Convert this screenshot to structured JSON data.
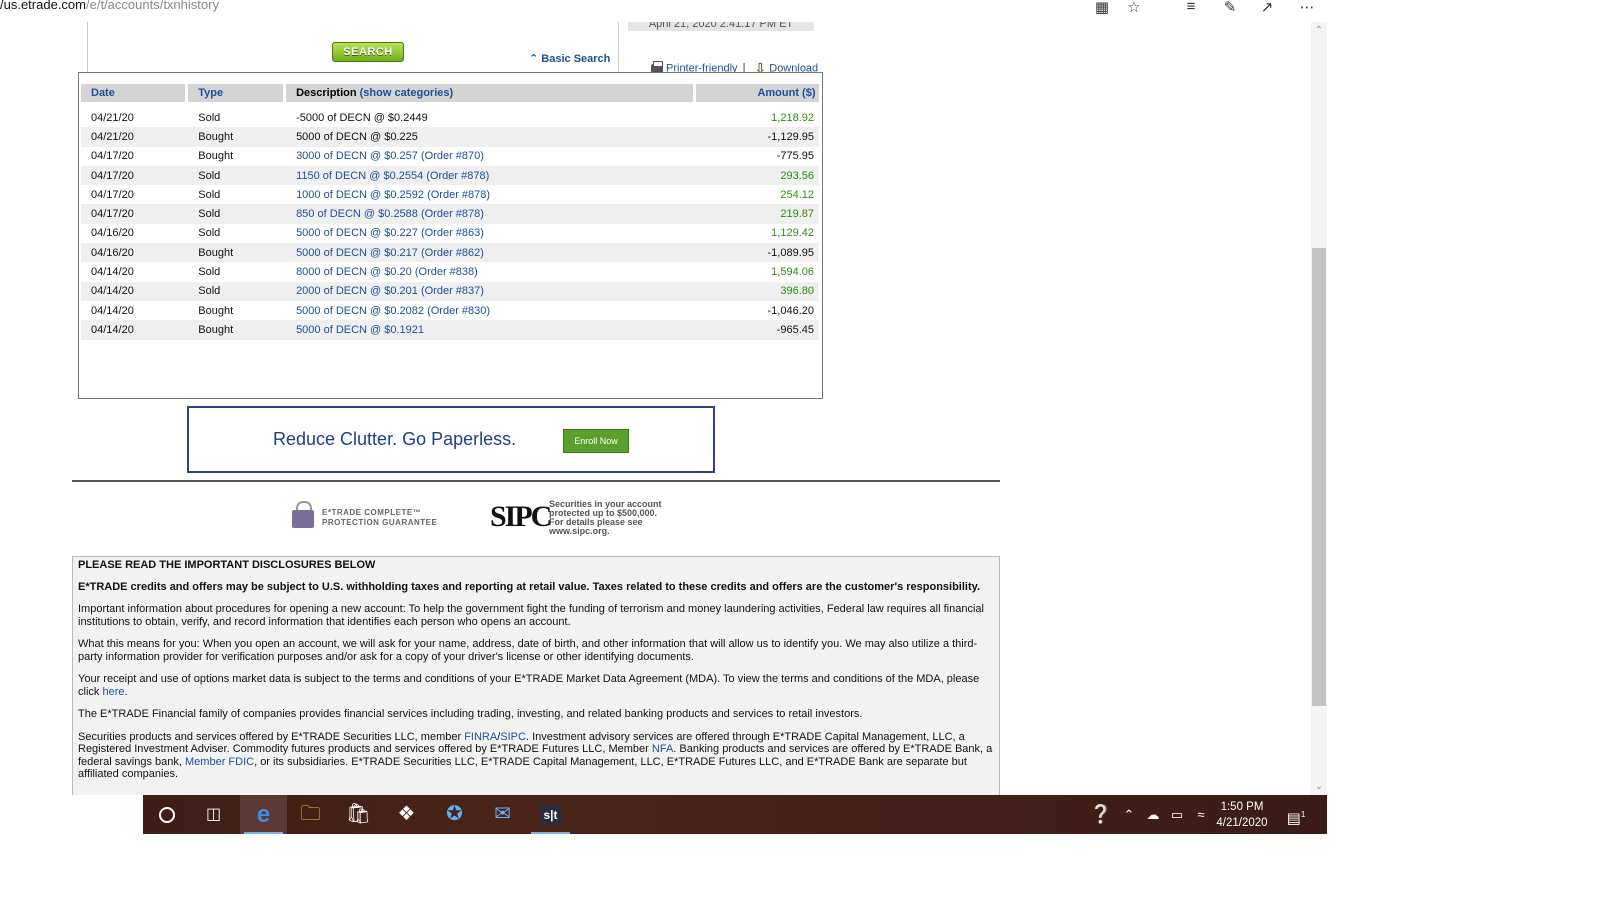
{
  "browser": {
    "url_domain": "/us.etrade.com",
    "url_path": "/e/t/accounts/txnhistory"
  },
  "search": {
    "button_label": "SEARCH",
    "basic_search_label": "Basic Search",
    "timestamp": "April 21, 2020 2:41:17 PM ET"
  },
  "actions": {
    "printer_label": "Printer-friendly",
    "separator": "|",
    "download_label": "Download"
  },
  "table": {
    "headers": {
      "date": "Date",
      "type": "Type",
      "description": "Description",
      "show_categories": "(show categories)",
      "amount": "Amount ($)"
    },
    "rows": [
      {
        "date": "04/21/20",
        "type": "Sold",
        "description": "-5000 of DECN @ $0.2449",
        "amount": "1,218.92",
        "positive": true,
        "link": false
      },
      {
        "date": "04/21/20",
        "type": "Bought",
        "description": "5000 of DECN @ $0.225",
        "amount": "-1,129.95",
        "positive": false,
        "link": false
      },
      {
        "date": "04/17/20",
        "type": "Bought",
        "description": "3000 of DECN @ $0.257 (Order #870)",
        "amount": "-775.95",
        "positive": false,
        "link": true
      },
      {
        "date": "04/17/20",
        "type": "Sold",
        "description": "1150 of DECN @ $0.2554 (Order #878)",
        "amount": "293.56",
        "positive": true,
        "link": true
      },
      {
        "date": "04/17/20",
        "type": "Sold",
        "description": "1000 of DECN @ $0.2592 (Order #878)",
        "amount": "254.12",
        "positive": true,
        "link": true
      },
      {
        "date": "04/17/20",
        "type": "Sold",
        "description": "850 of DECN @ $0.2588 (Order #878)",
        "amount": "219.87",
        "positive": true,
        "link": true
      },
      {
        "date": "04/16/20",
        "type": "Sold",
        "description": "5000 of DECN @ $0.227 (Order #863)",
        "amount": "1,129.42",
        "positive": true,
        "link": true
      },
      {
        "date": "04/16/20",
        "type": "Bought",
        "description": "5000 of DECN @ $0.217 (Order #862)",
        "amount": "-1,089.95",
        "positive": false,
        "link": true
      },
      {
        "date": "04/14/20",
        "type": "Sold",
        "description": "8000 of DECN @ $0.20 (Order #838)",
        "amount": "1,594.06",
        "positive": true,
        "link": true
      },
      {
        "date": "04/14/20",
        "type": "Sold",
        "description": "2000 of DECN @ $0.201 (Order #837)",
        "amount": "396.80",
        "positive": true,
        "link": true
      },
      {
        "date": "04/14/20",
        "type": "Bought",
        "description": "5000 of DECN @ $0.2082 (Order #830)",
        "amount": "-1,046.20",
        "positive": false,
        "link": true
      },
      {
        "date": "04/14/20",
        "type": "Bought",
        "description": "5000 of DECN @ $0.1921",
        "amount": "-965.45",
        "positive": false,
        "link": true
      }
    ]
  },
  "paperless": {
    "text": "Reduce Clutter. Go Paperless.",
    "button": "Enroll Now"
  },
  "logos": {
    "guarantee_line1": "E*TRADE COMPLETE™",
    "guarantee_line2": "PROTECTION GUARANTEE",
    "sipc_mark": "SIPC",
    "sipc_line1": "Securities in your account",
    "sipc_line2": "protected up to $500,000.",
    "sipc_line3": "For details please see",
    "sipc_line4": "www.sipc.org."
  },
  "disclosures": {
    "title": "PLEASE READ THE IMPORTANT DISCLOSURES BELOW",
    "p1": "E*TRADE credits and offers may be subject to U.S. withholding taxes and reporting at retail value. Taxes related to these credits and offers are the customer's responsibility.",
    "p2": "Important information about procedures for opening a new account: To help the government fight the funding of terrorism and money laundering activities, Federal law requires all financial institutions to obtain, verify, and record information that identifies each person who opens an account.",
    "p3": "What this means for you: When you open an account, we will ask for your name, address, date of birth, and other information that will allow us to identify you. We may also utilize a third-party information provider for verification purposes and/or ask for a copy of your driver's license or other identifying documents.",
    "p4_text": "Your receipt and use of options market data is subject to the terms and conditions of your E*TRADE Market Data Agreement (MDA). To view the terms and conditions of the MDA, please click",
    "p4_link": "here",
    "p5": "The E*TRADE Financial family of companies provides financial services including trading, investing, and related banking products and services to retail investors.",
    "p6_a": "Securities products and services offered by E*TRADE Securities LLC, member",
    "p6_finra": "FINRA",
    "p6_slash": "/",
    "p6_sipc": "SIPC",
    "p6_b": ". Investment advisory services are offered through E*TRADE Capital Management, LLC, a Registered Investment Adviser. Commodity futures products and services offered by E*TRADE Futures LLC, Member",
    "p6_nfa": "NFA",
    "p6_c": ". Banking products and services are offered by E*TRADE Bank, a federal savings bank,",
    "p6_fdic": "Member FDIC",
    "p6_d": ", or its subsidiaries. E*TRADE Securities LLC, E*TRADE Capital Management, LLC, E*TRADE Futures LLC, and E*TRADE Bank are separate but affiliated companies."
  },
  "taskbar": {
    "time": "1:50 PM",
    "date": "4/21/2020",
    "notification_count": "1",
    "app_label_st": "s|t"
  },
  "colors": {
    "link": "#1f4e9a",
    "positive_amount": "#2e8b14",
    "taskbar": "#3a1c14"
  }
}
